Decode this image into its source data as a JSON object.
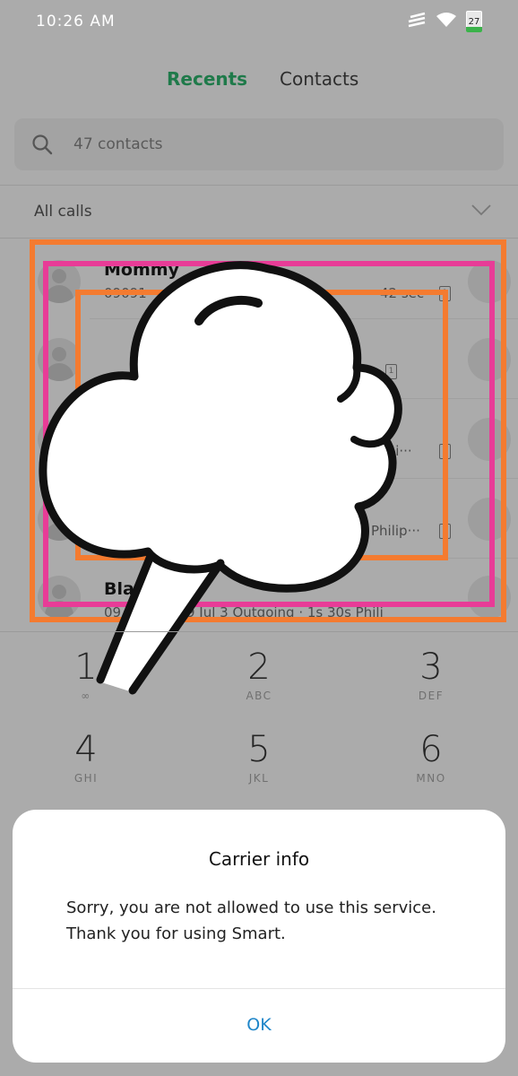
{
  "status": {
    "time": "10:26 AM",
    "battery": "27"
  },
  "tabs": {
    "recents": "Recents",
    "contacts": "Contacts"
  },
  "search": {
    "placeholder": "47 contacts"
  },
  "filter": {
    "label": "All calls"
  },
  "calls": [
    {
      "name": "Mommy",
      "detail_left": "09091",
      "detail_right": "42 sec"
    },
    {
      "name": "",
      "detail_left": "",
      "detail_right": ""
    },
    {
      "name": "",
      "detail_left": "",
      "detail_right": "ippi···"
    },
    {
      "name": "",
      "detail_left": "",
      "detail_right": "Philip···"
    },
    {
      "name": "Blai",
      "detail_left": "09",
      "detail_right": "9 Jul 3 Outgoing · 1s 30s Phili"
    }
  ],
  "dialpad": [
    {
      "digit": "1",
      "letters": "∞"
    },
    {
      "digit": "2",
      "letters": "ABC"
    },
    {
      "digit": "3",
      "letters": "DEF"
    },
    {
      "digit": "4",
      "letters": "GHI"
    },
    {
      "digit": "5",
      "letters": "JKL"
    },
    {
      "digit": "6",
      "letters": "MNO"
    }
  ],
  "dialog": {
    "title": "Carrier info",
    "message": "Sorry, you are not allowed to use this service. Thank you for using Smart.",
    "ok": "OK"
  },
  "colors": {
    "accent_green": "#1f7a4a",
    "ok_blue": "#1f86c9",
    "annotation_orange": "#f47b30",
    "annotation_pink": "#e83c97"
  }
}
